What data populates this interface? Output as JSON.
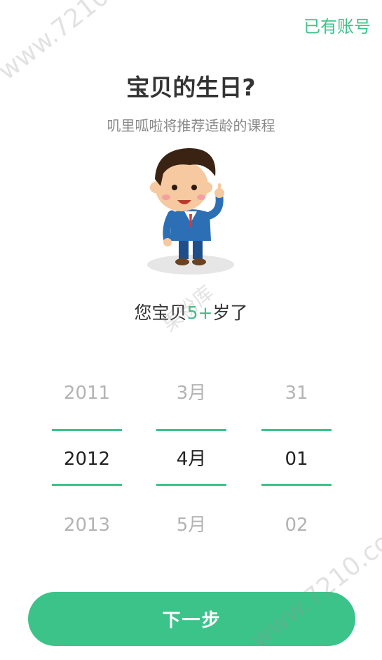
{
  "header": {
    "login_link": "已有账号"
  },
  "title": "宝贝的生日?",
  "subtitle": "叽里呱啦将推荐适龄的课程",
  "age_prefix": "您宝贝",
  "age_value": "5+",
  "age_suffix": "岁了",
  "picker": {
    "years": [
      "2011",
      "2012",
      "2013"
    ],
    "months": [
      "3月",
      "4月",
      "5月"
    ],
    "days": [
      "31",
      "01",
      "02"
    ],
    "selected_index": 1
  },
  "next_button": "下一步",
  "watermarks": {
    "site": "www.7210.com",
    "cn": "果粉库"
  },
  "colors": {
    "accent": "#3cc38a"
  }
}
